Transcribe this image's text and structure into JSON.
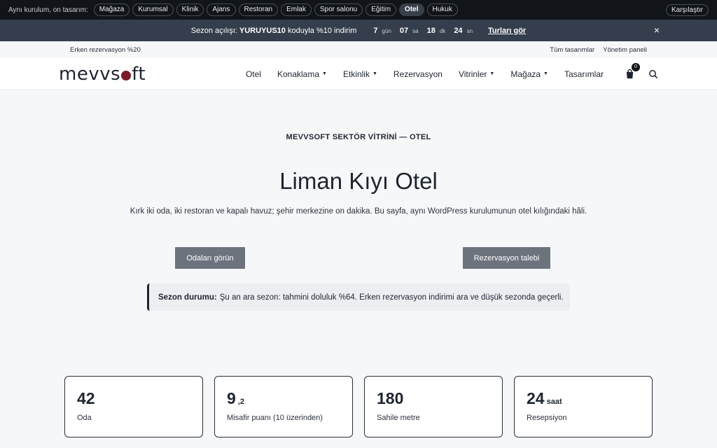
{
  "demo_bar": {
    "label": "Aynı kurulum, on tasarım:",
    "pills": [
      "Mağaza",
      "Kurumsal",
      "Klinik",
      "Ajans",
      "Restoran",
      "Emlak",
      "Spor salonu",
      "Eğitim",
      "Otel",
      "Hukuk"
    ],
    "active": "Otel",
    "compare": "Karşılaştır"
  },
  "promo": {
    "prefix": "Sezon açılışı:",
    "code": "YURUYUS10",
    "suffix": "koduyla %10 indirim",
    "days": "7",
    "days_unit": "gün",
    "hours": "07",
    "hours_unit": "sa",
    "minutes": "18",
    "minutes_unit": "dk",
    "seconds": "24",
    "seconds_unit": "sn",
    "link": "Turları gör",
    "close": "×"
  },
  "util": {
    "left": "Erken rezervasyon %20",
    "links": [
      "Tüm tasarımlar",
      "Yönetim paneli"
    ]
  },
  "nav": {
    "logo_a": "mevvs",
    "logo_b": "ft",
    "items": [
      {
        "label": "Otel",
        "dropdown": false
      },
      {
        "label": "Konaklama",
        "dropdown": true
      },
      {
        "label": "Etkinlik",
        "dropdown": true
      },
      {
        "label": "Rezervasyon",
        "dropdown": false
      },
      {
        "label": "Vitrinler",
        "dropdown": true
      },
      {
        "label": "Mağaza",
        "dropdown": true
      },
      {
        "label": "Tasarımlar",
        "dropdown": false
      }
    ],
    "cart_count": "0"
  },
  "hero": {
    "eyebrow": "MEVVSOFT SEKTÖR VİTRİNİ — OTEL",
    "title": "Liman Kıyı Otel",
    "subtitle": "Kırk iki oda, iki restoran ve kapalı havuz; şehir merkezine on dakika. Bu sayfa, aynı WordPress kurulumunun otel kılığındaki hâli.",
    "btn_rooms": "Odaları görün",
    "btn_reserve": "Rezervasyon talebi"
  },
  "notice": {
    "label": "Sezon durumu:",
    "text": "Şu an ara sezon: tahmini doluluk %64. Erken rezervasyon indirimi ara ve düşük sezonda geçerli."
  },
  "stats": [
    {
      "value": "42",
      "suffix": "",
      "label": "Oda"
    },
    {
      "value": "9",
      "suffix": ",2",
      "label": "Misafir puanı (10 üzerinden)"
    },
    {
      "value": "180",
      "suffix": "",
      "label": "Sahile metre"
    },
    {
      "value": "24",
      "suffix": "saat",
      "label": "Resepsiyon"
    }
  ]
}
